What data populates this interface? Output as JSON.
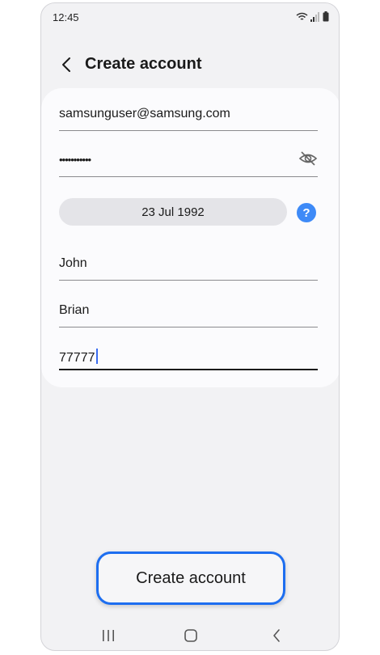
{
  "status_bar": {
    "time": "12:45"
  },
  "header": {
    "title": "Create account"
  },
  "form": {
    "email": "samsunguser@samsung.com",
    "password_masked": "•••••••••••",
    "birth_date": "23 Jul 1992",
    "first_name": "John",
    "last_name": "Brian",
    "postal_code": "77777"
  },
  "actions": {
    "create_label": "Create account"
  },
  "colors": {
    "accent": "#1d6ef0",
    "help": "#3e8af7",
    "background": "#f2f2f4"
  }
}
